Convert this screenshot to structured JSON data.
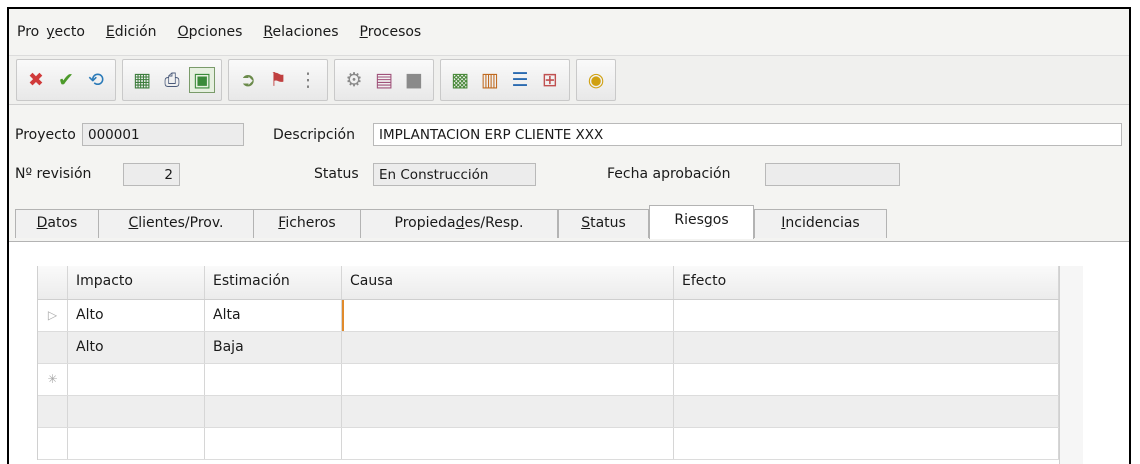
{
  "menu": [
    {
      "pre": "Pro",
      "key": "y",
      "post": "ecto"
    },
    {
      "pre": "",
      "key": "E",
      "post": "dición"
    },
    {
      "pre": "",
      "key": "O",
      "post": "pciones"
    },
    {
      "pre": "",
      "key": "R",
      "post": "elaciones"
    },
    {
      "pre": "",
      "key": "P",
      "post": "rocesos"
    }
  ],
  "toolbar": {
    "groups": [
      [
        {
          "name": "cancel-icon",
          "glyph": "✖",
          "color": "#d03a3a"
        },
        {
          "name": "accept-icon",
          "glyph": "✔",
          "color": "#4c9a2a"
        },
        {
          "name": "refresh-icon",
          "glyph": "⟲",
          "color": "#2a7ab8"
        }
      ],
      [
        {
          "name": "spreadsheet-icon",
          "glyph": "▦",
          "color": "#3d7d3d"
        },
        {
          "name": "printer-icon",
          "glyph": "⎙",
          "color": "#4a5a7a"
        },
        {
          "name": "export-icon",
          "glyph": "▣",
          "color": "#3a8a3a",
          "pressed": true
        }
      ],
      [
        {
          "name": "document-arrow-icon",
          "glyph": "➲",
          "color": "#6a8a4a"
        },
        {
          "name": "document-flag-icon",
          "glyph": "⚑",
          "color": "#c04040"
        },
        {
          "name": "tree-icon",
          "glyph": "⋮",
          "color": "#808080"
        }
      ],
      [
        {
          "name": "gear-icon",
          "glyph": "⚙",
          "color": "#8a8a8a"
        },
        {
          "name": "book-icon",
          "glyph": "▤",
          "color": "#a0527a"
        },
        {
          "name": "square-icon",
          "glyph": "■",
          "color": "#8a8a8a"
        }
      ],
      [
        {
          "name": "chart-icon",
          "glyph": "▩",
          "color": "#4a8a3a"
        },
        {
          "name": "report-icon",
          "glyph": "▥",
          "color": "#c06a20"
        },
        {
          "name": "list-icon",
          "glyph": "☰",
          "color": "#2a6ab0"
        },
        {
          "name": "hierarchy-icon",
          "glyph": "⊞",
          "color": "#c05050"
        }
      ],
      [
        {
          "name": "coin-icon",
          "glyph": "◉",
          "color": "#d0a010"
        }
      ]
    ]
  },
  "form": {
    "proyecto_label": "Proyecto",
    "proyecto_value": "000001",
    "descripcion_label": "Descripción",
    "descripcion_value": "IMPLANTACION ERP CLIENTE XXX",
    "revision_label": "Nº revisión",
    "revision_value": "2",
    "status_label": "Status",
    "status_value": "En Construcción",
    "fecha_label": "Fecha aprobación",
    "fecha_value": ""
  },
  "tabs": [
    {
      "key": "D",
      "rest": "atos",
      "pre": ""
    },
    {
      "pre": "",
      "key": "C",
      "rest": "lientes/Prov."
    },
    {
      "pre": "",
      "key": "F",
      "rest": "icheros"
    },
    {
      "pre": "Propieda",
      "key": "d",
      "rest": "es/Resp."
    },
    {
      "pre": "",
      "key": "S",
      "rest": "tatus"
    },
    {
      "pre": "Ries",
      "key": "g",
      "rest": "os",
      "active": true
    },
    {
      "pre": "",
      "key": "I",
      "rest": "ncidencias"
    }
  ],
  "grid": {
    "columns": [
      "Impacto",
      "Estimación",
      "Causa",
      "Efecto"
    ],
    "rows": [
      {
        "marker": "▷",
        "impacto": "Alto",
        "estimacion": "Alta",
        "causa": "",
        "efecto": ""
      },
      {
        "marker": "",
        "impacto": "Alto",
        "estimacion": "Baja",
        "causa": "",
        "efecto": ""
      },
      {
        "marker": "✳",
        "impacto": "",
        "estimacion": "",
        "causa": "",
        "efecto": ""
      },
      {
        "marker": "",
        "impacto": "",
        "estimacion": "",
        "causa": "",
        "efecto": ""
      },
      {
        "marker": "",
        "impacto": "",
        "estimacion": "",
        "causa": "",
        "efecto": ""
      }
    ]
  }
}
